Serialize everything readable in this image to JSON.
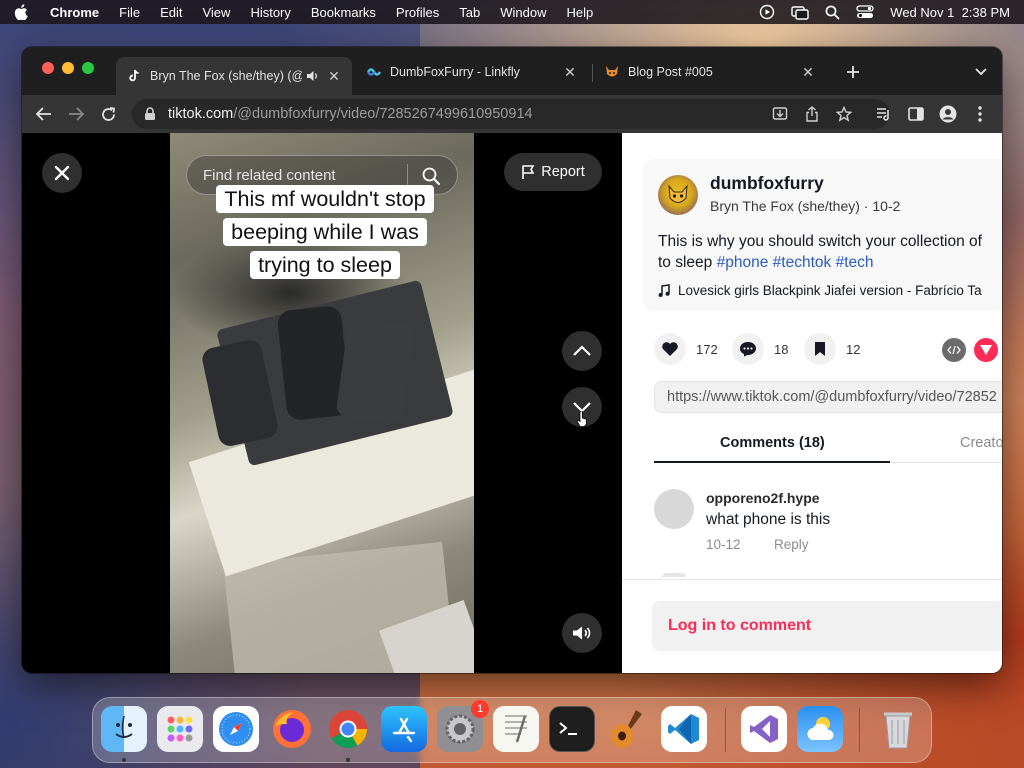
{
  "menubar": {
    "app": "Chrome",
    "items": [
      "File",
      "Edit",
      "View",
      "History",
      "Bookmarks",
      "Profiles",
      "Tab",
      "Window",
      "Help"
    ],
    "datetime": "Wed Nov 1  2:38 PM"
  },
  "tabs": [
    {
      "title": "Bryn The Fox (she/they) (@",
      "icon": "tiktok-icon",
      "audio": true,
      "active": true
    },
    {
      "title": "DumbFoxFurry - Linkfly",
      "icon": "linkfly-icon",
      "active": false
    },
    {
      "title": "Blog Post #005",
      "icon": "fox-icon",
      "active": false
    }
  ],
  "omnibox": {
    "domain": "tiktok.com",
    "path": "/@dumbfoxfurry/video/7285267499610950914"
  },
  "video": {
    "search_placeholder": "Find related content",
    "caption_lines": [
      "This mf wouldn't stop",
      "beeping while I was",
      "trying to sleep"
    ],
    "report_label": "Report"
  },
  "post": {
    "username": "dumbfoxfurry",
    "display_name": "Bryn The Fox (she/they)",
    "date": "10-2",
    "description_prefix": "This is why you should switch your collection of",
    "description_line2_prefix": "to sleep",
    "hashtags": [
      "#phone",
      "#techtok",
      "#tech"
    ],
    "music": "Lovesick girls Blackpink Jiafei version - Fabrício Ta",
    "likes": "172",
    "comments": "18",
    "saves": "12",
    "link": "https://www.tiktok.com/@dumbfoxfurry/video/72852"
  },
  "comments_tabs": {
    "active": "Comments (18)",
    "inactive": "Creato"
  },
  "comment": {
    "user": "opporeno2f.hype",
    "text": "what phone is this",
    "date": "10-12",
    "reply": "Reply"
  },
  "login_prompt": "Log in to comment",
  "dock": {
    "apps": [
      "finder",
      "launchpad",
      "safari",
      "firefox",
      "chrome",
      "app-store",
      "system-settings",
      "textedit",
      "terminal",
      "garageband",
      "vscode",
      "visual-studio",
      "weather",
      "trash"
    ],
    "settings_badge": "1"
  },
  "colors": {
    "tiktok_red": "#fe2c55",
    "hashtag_blue": "#2b5db9",
    "chrome_dark": "#353535"
  }
}
